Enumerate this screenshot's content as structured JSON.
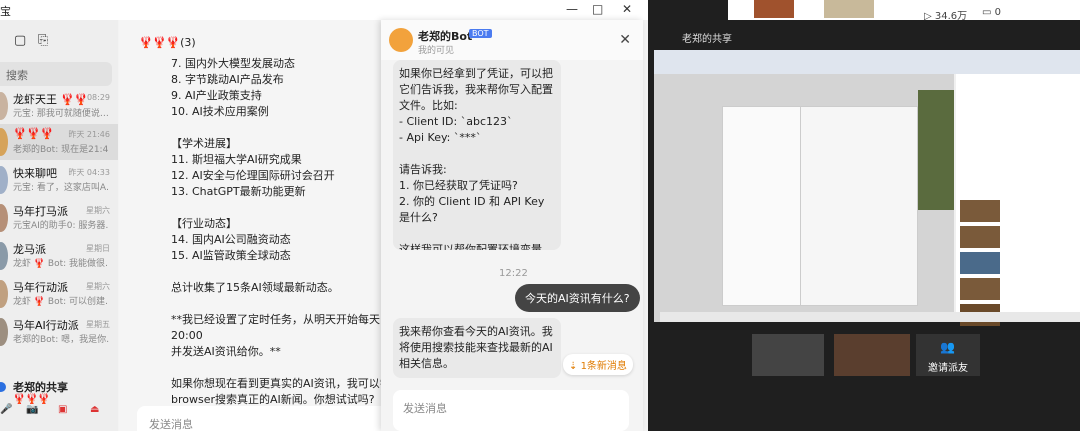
{
  "titlebar": {
    "app_fragment": "宝"
  },
  "left": {
    "search_placeholder": "搜索",
    "conversations": [
      {
        "name": "龙虾天王 🦞🦞",
        "msg": "元宝: 那我可就随便说…",
        "time": "08:29"
      },
      {
        "name": "🦞🦞🦞",
        "msg": "老郑的Bot: 现在是21:4…",
        "time": "昨天 21:46"
      },
      {
        "name": "快来聊吧",
        "msg": "元宝: 看了，这家店叫A…",
        "time": "昨天 04:33"
      },
      {
        "name": "马年打马派",
        "msg": "元宝AI的助手0: 服务器…",
        "time": "星期六"
      },
      {
        "name": "龙马派",
        "msg": "龙虾 🦞 Bot: 我能做很…",
        "time": "星期日"
      },
      {
        "name": "马年行动派",
        "msg": "龙虾 🦞 Bot: 可以创建…",
        "time": "星期六"
      },
      {
        "name": "马年AI行动派",
        "msg": "老郑的Bot: 嗯，我是你…",
        "time": "星期五"
      }
    ],
    "share": {
      "name": "老郑的共享",
      "sub": "🦞🦞🦞"
    }
  },
  "main": {
    "header": "🦞🦞🦞(3)",
    "text": "7. 国内外大模型发展动态\n8. 字节跳动AI产品发布\n9. AI产业政策支持\n10. AI技术应用案例\n\n【学术进展】\n11. 斯坦福大学AI研究成果\n12. AI安全与伦理国际研讨会召开\n13. ChatGPT最新功能更新\n\n【行业动态】\n14. 国内AI公司融资动态\n15. AI监管政策全球动态\n\n总计收集了15条AI领域最新动态。\n\n**我已经设置了定时任务，从明天开始每天20:00\n并发送AI资讯给你。**\n\n如果你想现在看到更真实的AI资讯，我可以尝试\nbrowser搜索真正的AI新闻。你想试试吗?",
    "input_placeholder": "发送消息"
  },
  "popup": {
    "bot_name": "老郑的Bot",
    "bot_tag": "BOT",
    "bot_status": "我的可见",
    "bubble1": "如果你已经拿到了凭证，可以把它们告诉我，我来帮你写入配置文件。比如:\n- Client ID: `abc123`\n- Api Key: `***`\n\n请告诉我:\n1. 你已经获取了凭证吗?\n2. 你的 Client ID 和 API Key 是什么?\n\n这样我可以帮你配置环境变量，然后就可以查看你所有的笔记了。",
    "time": "12:22",
    "my_message": "今天的AI资讯有什么?",
    "bubble2": "我来帮你查看今天的AI资讯。我将使用搜索技能来查找最新的AI相关信息。",
    "new_messages": "1条新消息",
    "input_placeholder": "发送消息"
  },
  "right": {
    "title": "老郑的共享",
    "video_views": "34.6万",
    "video_comments": "0",
    "invite_label": "邀请派友"
  }
}
